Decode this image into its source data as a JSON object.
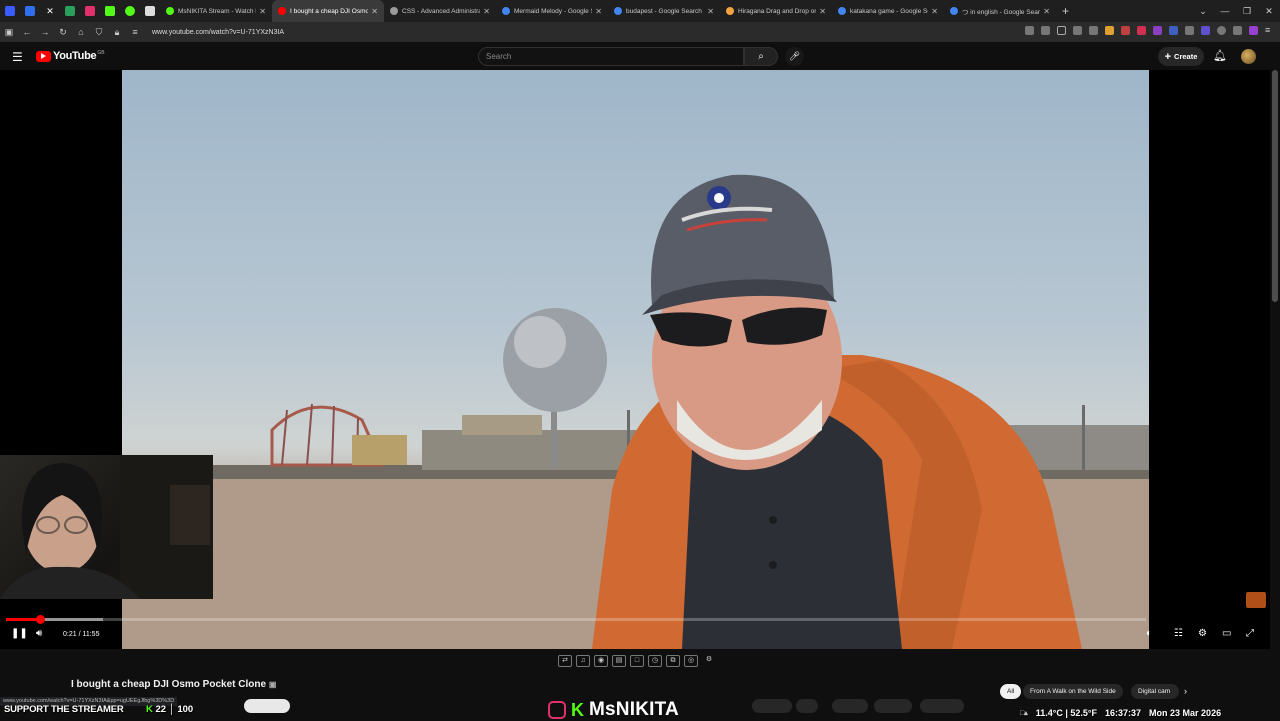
{
  "browser": {
    "tabs": [
      {
        "title": "MsNIKITA Stream - Watch Live",
        "fav": "#53fc18"
      },
      {
        "title": "I bought a cheap DJI Osmo",
        "fav": "#ff0000",
        "active": true
      },
      {
        "title": "CSS - Advanced Administratio",
        "fav": "#9a9a9a"
      },
      {
        "title": "Mermaid Melody - Google Sea",
        "fav": "#4285f4"
      },
      {
        "title": "budapest - Google Search",
        "fav": "#4285f4"
      },
      {
        "title": "Hiragana Drag and Drop or Ka",
        "fav": "#f4a340"
      },
      {
        "title": "katakana game - Google Search",
        "fav": "#4285f4"
      },
      {
        "title": "つ in english - Google Search",
        "fav": "#4285f4"
      }
    ],
    "new_tab": "+",
    "url": "www.youtube.com/watch?v=U-71YXzN3IA"
  },
  "youtube": {
    "logo_text": "YouTube",
    "logo_country": "GB",
    "search_placeholder": "Search",
    "create_label": "Create"
  },
  "player": {
    "time": "0:21 / 11:55",
    "progress_played": 0.0294,
    "progress_loaded": 0.085
  },
  "video": {
    "title": "I bought a cheap DJI Osmo Pocket Clone",
    "chips": [
      "All",
      "From A Walk on the Wild Side",
      "Digital cam"
    ]
  },
  "overlay": {
    "status_url": "www.youtube.com/watch?v=U-71YXzN3IA&pp=ugUEEgJlbg%3D%3D",
    "support_text": "SUPPORT THE STREAMER",
    "counter_a": "22",
    "counter_b": "100",
    "brand_kick": "K",
    "brand_name": "MsNIKITA",
    "weather": "11.4°C | 52.5°F",
    "clock": "16:37:37",
    "date": "Mon 23 Mar 2026"
  },
  "colors": {
    "yt_red": "#ff0000",
    "kick_green": "#53fc18",
    "jacket": "#d06a32"
  }
}
